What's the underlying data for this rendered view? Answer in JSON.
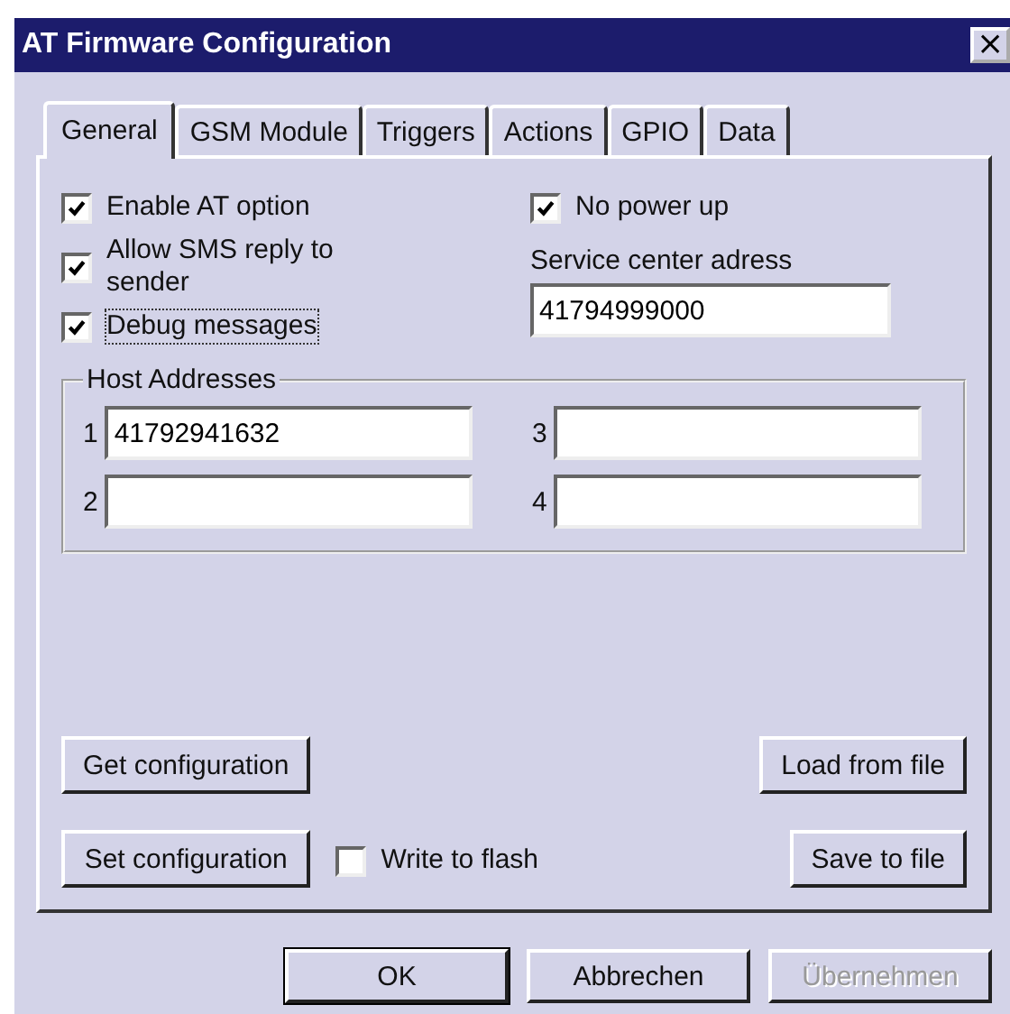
{
  "window": {
    "title": "AT Firmware Configuration",
    "close": "×"
  },
  "tabs": [
    {
      "label": "General",
      "selected": true
    },
    {
      "label": "GSM Module",
      "selected": false
    },
    {
      "label": "Triggers",
      "selected": false
    },
    {
      "label": "Actions",
      "selected": false
    },
    {
      "label": "GPIO",
      "selected": false
    },
    {
      "label": "Data",
      "selected": false
    }
  ],
  "options": [
    {
      "label": "Enable AT option",
      "checked": true,
      "focused": false
    },
    {
      "label": "Allow SMS reply to sender",
      "checked": true,
      "focused": false
    },
    {
      "label": "Debug messages",
      "checked": true,
      "focused": true
    }
  ],
  "no_power_up": {
    "label": "No power up",
    "checked": true
  },
  "service_center": {
    "label": "Service center adress",
    "value": "41794999000"
  },
  "host_addresses": {
    "title": "Host Addresses",
    "fields": [
      {
        "number": "1",
        "value": "41792941632"
      },
      {
        "number": "3"
      },
      {
        "number": "2"
      },
      {
        "number": "4"
      }
    ]
  },
  "left_buttons": [
    "Get configuration",
    "Set configuration"
  ],
  "write_to_flash": {
    "label": "Write to flash",
    "checked": false
  },
  "right_buttons": [
    "Load from file",
    "Save to file"
  ],
  "dialog_buttons": [
    {
      "label": "OK",
      "default": true,
      "disabled": false
    },
    {
      "label": "Abbrechen",
      "default": false,
      "disabled": false
    },
    {
      "label": "Übernehmen",
      "default": false,
      "disabled": true
    }
  ]
}
